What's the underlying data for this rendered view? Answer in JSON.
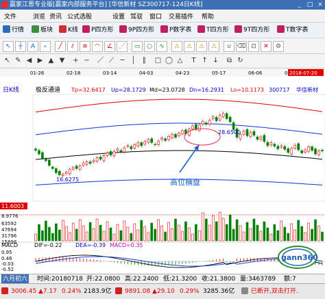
{
  "window": {
    "title": "赢家江恩专业版[赢家内部服务平台]  [华信新材  SZ300717-124日K线]",
    "controls": [
      "_",
      "□",
      "×"
    ]
  },
  "menu": [
    "文件",
    "浏览",
    "资讯",
    "公式选股",
    "设置",
    "驾驭",
    "窗口",
    "交易插件",
    "帮助"
  ],
  "toolbar1": [
    {
      "label": "行情",
      "icon": "grid-icon",
      "color": "#2d6db5"
    },
    {
      "label": "板块",
      "icon": "blocks-icon",
      "color": "#3b8f3b"
    },
    {
      "label": "K线",
      "icon": "candle-icon",
      "color": "#d03030"
    },
    {
      "label": "P四方形",
      "icon": "square-p-icon",
      "color": "#c02060"
    },
    {
      "label": "9P四方形",
      "icon": "square-9p-icon",
      "color": "#c02060"
    },
    {
      "label": "P数字表",
      "icon": "table-p-icon",
      "color": "#c02060"
    },
    {
      "label": "T四方形",
      "icon": "square-t-icon",
      "color": "#c02060"
    },
    {
      "label": "9T四方形",
      "icon": "square-9t-icon",
      "color": "#c02060"
    },
    {
      "label": "T数字表",
      "icon": "table-t-icon",
      "color": "#c02060"
    }
  ],
  "chart_header": {
    "period": "日K线",
    "indicator": "极反通道",
    "tp": "Tp=32.6417",
    "up": "Up=28.1729",
    "md": "Md=23.0728",
    "dn": "Dn=16.2931",
    "lo": "Lo=10.1173",
    "code": "300717",
    "name": "华信新材"
  },
  "date_ticks": [
    "01-26",
    "02-18",
    "03-14",
    "04-03",
    "04-23",
    "05-17",
    "06-06",
    "06-27"
  ],
  "date_highlight": "2018-07-20",
  "price_labels": {
    "high": "28.6500",
    "low": "16.6275"
  },
  "annotation": "高位横盘",
  "volume": {
    "axis_top": "11.6003",
    "axis_2": "8.9776",
    "v1": "63592",
    "v2": "47694",
    "v3": "31796",
    "v4": "15898"
  },
  "macd": {
    "label": "MACD",
    "dif": "DIF=-0.22",
    "dea": "DEA=-0.39",
    "macd": "MACD=0.35",
    "axis": [
      "0.95",
      "0.46",
      "-0.03",
      "-0.52",
      "-1.01"
    ]
  },
  "logo_text": "gann360",
  "status1": {
    "board": "六月初六",
    "date": "时间:20180718",
    "open": "开:22.0800",
    "high": "高:22.2400",
    "low": "低:21.3200",
    "close": "收:21.3800",
    "vol": "量:3463789",
    "amt": "额:7"
  },
  "status2": {
    "sh": "3006.45",
    "sh_chg": "▲7.17",
    "sh_pct": "0.24%",
    "sh_amt": "2183.9亿",
    "sz": "9891.08",
    "sz_chg": "▲29.10",
    "sz_pct": "0.29%",
    "sz_amt": "3285.36亿",
    "state": "已断开,双击打开."
  },
  "chart_data": {
    "type": "candlestick",
    "x_ticks": [
      "01-26",
      "02-18",
      "03-14",
      "04-03",
      "04-23",
      "05-17",
      "06-06",
      "06-27"
    ],
    "y_price_range": [
      12,
      32
    ],
    "series": [
      {
        "name": "Tp",
        "label_value": 32.6417
      },
      {
        "name": "Up",
        "label_value": 28.1729
      },
      {
        "name": "Md",
        "label_value": 23.0728
      },
      {
        "name": "Dn",
        "label_value": 16.2931
      },
      {
        "name": "Lo",
        "label_value": 10.1173
      }
    ],
    "closes": [
      21.5,
      20.8,
      20.0,
      19.5,
      18.6,
      18.0,
      17.2,
      16.8,
      16.9,
      17.3,
      17.9,
      18.2,
      18.0,
      18.5,
      19.1,
      19.3,
      19.0,
      19.6,
      20.1,
      19.8,
      20.5,
      21.0,
      20.6,
      21.3,
      21.8,
      21.2,
      22.0,
      22.4,
      21.8,
      22.6,
      23.0,
      22.4,
      23.2,
      23.6,
      23.0,
      22.6,
      23.3,
      23.9,
      23.4,
      24.2,
      24.6,
      24.0,
      24.8,
      25.3,
      24.7,
      25.6,
      26.2,
      25.5,
      26.4,
      27.1,
      26.5,
      27.3,
      28.0,
      27.2,
      28.3,
      28.6,
      27.6,
      27.0,
      25.5,
      24.0,
      24.6,
      25.2,
      24.3,
      25.0,
      24.4,
      23.6,
      24.1,
      23.2,
      22.4,
      23.0,
      22.3,
      21.8,
      22.4,
      21.7,
      21.1,
      21.9,
      22.5,
      21.6,
      21.0,
      21.6,
      22.2,
      21.5,
      20.8,
      21.4,
      21.38
    ],
    "annotations": [
      {
        "text": "28.6500",
        "kind": "high"
      },
      {
        "text": "16.6275",
        "kind": "low"
      },
      {
        "text": "高位横盘",
        "kind": "arrow-label"
      }
    ],
    "macd": {
      "dif": -0.22,
      "dea": -0.39,
      "macd": 0.35,
      "ylim": [
        -1.01,
        0.95
      ]
    }
  }
}
